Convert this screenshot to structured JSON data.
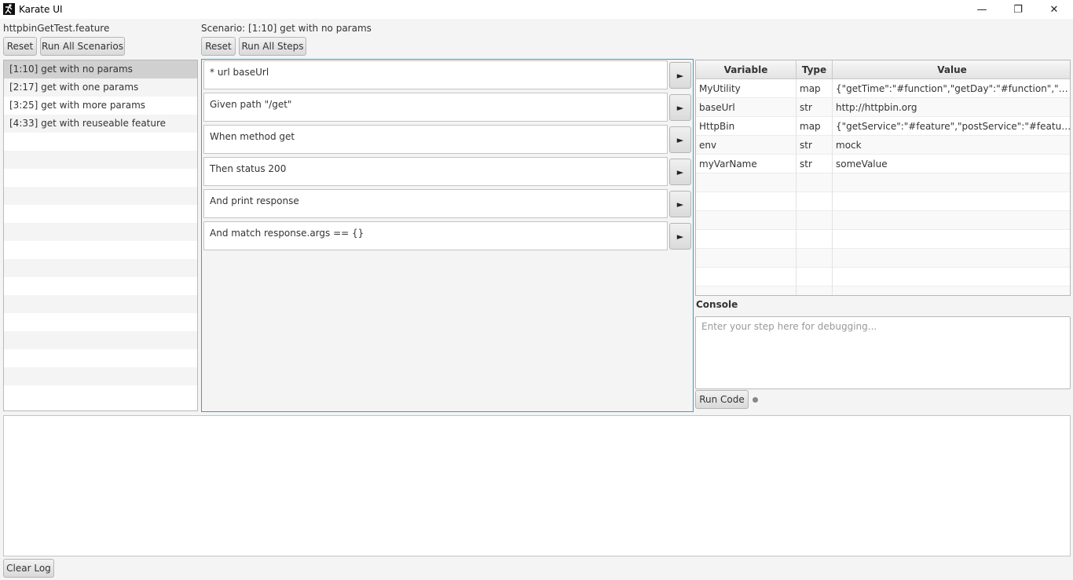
{
  "window": {
    "title": "Karate UI",
    "minimize_glyph": "—",
    "maximize_glyph": "❐",
    "close_glyph": "✕",
    "logo_icon": "karate-figure-icon"
  },
  "feature": {
    "file_name": "httpbinGetTest.feature",
    "reset_label": "Reset",
    "run_all_label": "Run All Scenarios",
    "scenarios": [
      {
        "label": "[1:10] get with no params"
      },
      {
        "label": "[2:17] get with one params"
      },
      {
        "label": "[3:25] get with more params"
      },
      {
        "label": "[4:33] get with reuseable feature"
      }
    ]
  },
  "scenario": {
    "title": "Scenario: [1:10] get with no params",
    "reset_label": "Reset",
    "run_all_label": "Run All Steps",
    "run_step_glyph": "►",
    "steps": [
      {
        "text": "* url baseUrl"
      },
      {
        "text": "Given path \"/get\""
      },
      {
        "text": "When method get"
      },
      {
        "text": "Then status 200"
      },
      {
        "text": "And print response"
      },
      {
        "text": "And match response.args == {}"
      }
    ]
  },
  "variables": {
    "headers": {
      "variable": "Variable",
      "type": "Type",
      "value": "Value"
    },
    "rows": [
      {
        "name": "MyUtility",
        "type": "map",
        "value": "{\"getTime\":\"#function\",\"getDay\":\"#function\",\"wait\":\"#f..."
      },
      {
        "name": "baseUrl",
        "type": "str",
        "value": "http://httpbin.org"
      },
      {
        "name": "HttpBin",
        "type": "map",
        "value": "{\"getService\":\"#feature\",\"postService\":\"#feature\"}"
      },
      {
        "name": "env",
        "type": "str",
        "value": "mock"
      },
      {
        "name": "myVarName",
        "type": "str",
        "value": "someValue"
      }
    ]
  },
  "console": {
    "label": "Console",
    "placeholder": "Enter your step here for debugging...",
    "run_label": "Run Code"
  },
  "log": {
    "content": "",
    "clear_label": "Clear Log"
  }
}
